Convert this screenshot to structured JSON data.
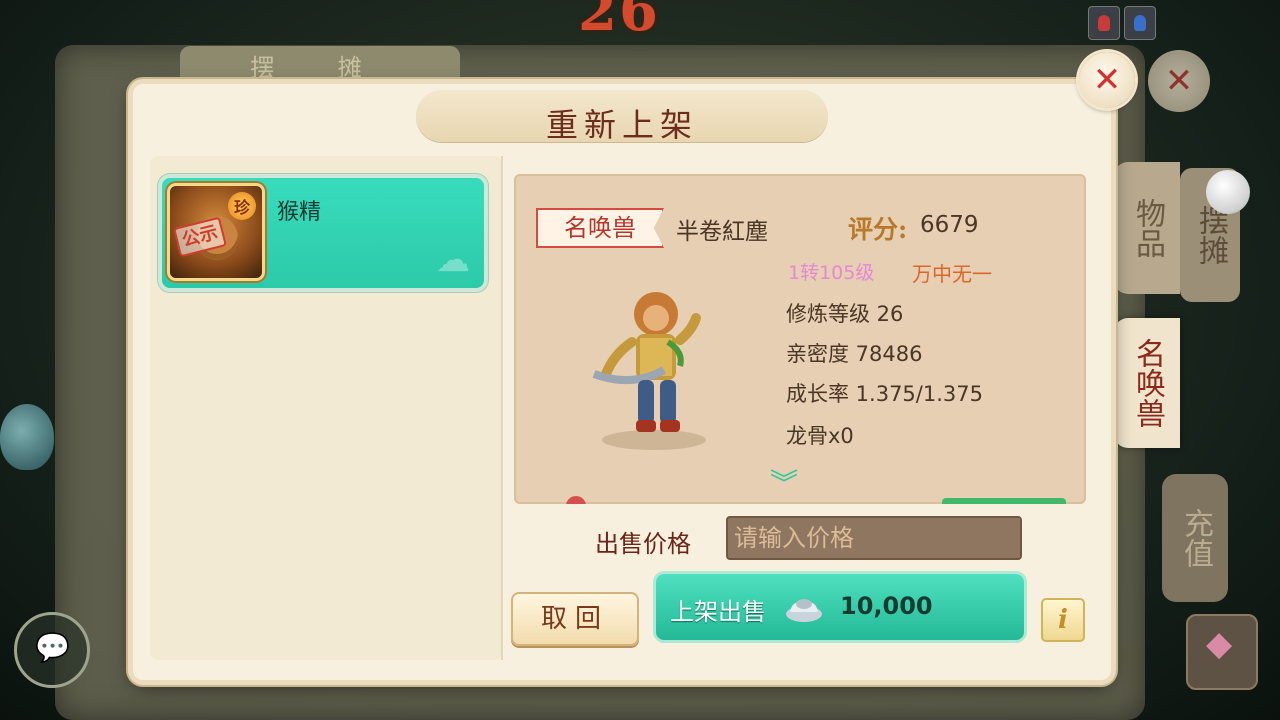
{
  "background": {
    "counter": "26",
    "stall_tab": "摆 摊",
    "icons": [
      "red-potion-icon",
      "blue-potion-icon",
      "chat-bubble-icon",
      "lantern-icon"
    ]
  },
  "side_tabs": {
    "items": "物品",
    "pets": "名唤兽",
    "recharge": "充值",
    "stall": "摆摊"
  },
  "modal": {
    "title": "重新上架",
    "close_icon": "close-icon"
  },
  "pet_list": [
    {
      "name": "猴精",
      "rare_badge": "珍",
      "stamp": "公示",
      "selected": true
    }
  ],
  "pet_detail": {
    "type_tag": "名唤兽",
    "name": "半卷紅塵",
    "score_label": "评分:",
    "score": "6679",
    "level": "1转105级",
    "rarity": "万中无一",
    "stats": [
      "修炼等级 26",
      "亲密度 78486",
      "成长率 1.375/1.375",
      "龙骨x0"
    ]
  },
  "sell_form": {
    "price_label": "出售价格",
    "price_placeholder": "请输入价格",
    "price_value": ""
  },
  "buttons": {
    "cancel": "取回",
    "sell_label": "上架出售",
    "fee_amount": "10,000",
    "fee_icon": "silver-ingot-icon",
    "info": "i"
  },
  "colors": {
    "accent_teal": "#2ccaa9",
    "title_brown": "#6d2d1d",
    "close_red": "#d0332f"
  }
}
